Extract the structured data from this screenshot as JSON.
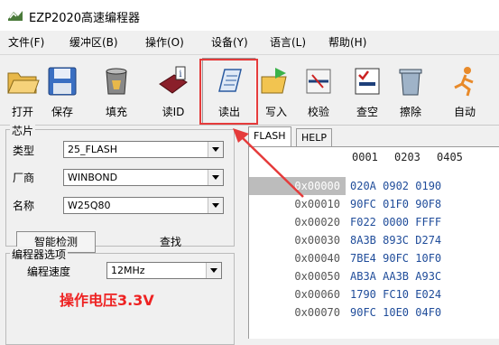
{
  "window": {
    "title": "EZP2020高速编程器"
  },
  "menu": [
    "文件(F)",
    "缓冲区(B)",
    "操作(O)",
    "设备(Y)",
    "语言(L)",
    "帮助(H)"
  ],
  "toolbar": {
    "open": "打开",
    "save": "保存",
    "fill": "填充",
    "read_id": "读ID",
    "read": "读出",
    "write": "写入",
    "verify": "校验",
    "blank": "查空",
    "erase": "擦除",
    "auto": "自动"
  },
  "chip": {
    "group_title": "芯片",
    "type_label": "类型",
    "type_value": "25_FLASH",
    "vendor_label": "厂商",
    "vendor_value": "WINBOND",
    "name_label": "名称",
    "name_value": "W25Q80",
    "detect_button": "智能检测",
    "find_button": "查找"
  },
  "programmer": {
    "group_title": "编程器选项",
    "speed_label": "编程速度",
    "speed_value": "12MHz",
    "voltage_label": "操作电压3.3V"
  },
  "tabs": [
    "FLASH",
    "HELP"
  ],
  "hex": {
    "header": [
      "0001",
      "0203",
      "0405"
    ],
    "rows": [
      {
        "addr": "0x00000",
        "data": "020A 0902 0190"
      },
      {
        "addr": "0x00010",
        "data": "90FC 01F0 90F8"
      },
      {
        "addr": "0x00020",
        "data": "F022 0000 FFFF"
      },
      {
        "addr": "0x00030",
        "data": "8A3B 893C D274"
      },
      {
        "addr": "0x00040",
        "data": "7BE4 90FC 10F0"
      },
      {
        "addr": "0x00050",
        "data": "AB3A AA3B A93C"
      },
      {
        "addr": "0x00060",
        "data": "1790 FC10 E024"
      },
      {
        "addr": "0x00070",
        "data": "90FC 10E0 04F0"
      }
    ]
  },
  "colors": {
    "highlight": "#e53b3b",
    "voltage": "#e22222",
    "hex_text": "#1f4c9a"
  }
}
